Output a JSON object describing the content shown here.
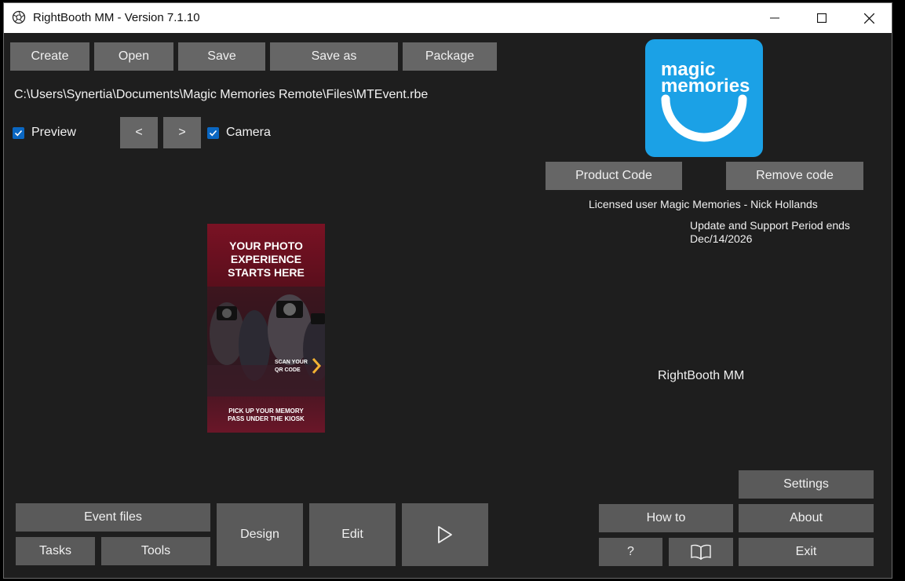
{
  "window": {
    "title": "RightBooth MM - Version 7.1.10"
  },
  "toolbar": {
    "create": "Create",
    "open": "Open",
    "save": "Save",
    "save_as": "Save as",
    "package": "Package"
  },
  "file_path": "C:\\Users\\Synertia\\Documents\\Magic Memories Remote\\Files\\MTEvent.rbe",
  "preview_check": {
    "label": "Preview",
    "checked": true
  },
  "camera_check": {
    "label": "Camera",
    "checked": true
  },
  "nav": {
    "prev": "<",
    "next": ">"
  },
  "logo": {
    "line1": "magic",
    "line2": "memories",
    "bg_color": "#1ba1e6"
  },
  "license": {
    "product_code": "Product Code",
    "remove_code": "Remove code",
    "licensed_user": "Licensed user Magic Memories - Nick Hollands",
    "support_line1": "Update and Support Period ends",
    "support_line2": "Dec/14/2026"
  },
  "app_name_label": "RightBooth MM",
  "poster": {
    "headline1": "YOUR PHOTO",
    "headline2": "EXPERIENCE",
    "headline3": "STARTS HERE",
    "scan1": "SCAN YOUR",
    "scan2": "QR CODE",
    "footer1": "PICK UP YOUR MEMORY",
    "footer2": "PASS UNDER THE KIOSK"
  },
  "bottom_left": {
    "event_files": "Event files",
    "tasks": "Tasks",
    "tools": "Tools",
    "design": "Design",
    "edit": "Edit"
  },
  "bottom_right": {
    "settings": "Settings",
    "how_to": "How to",
    "about": "About",
    "help": "?",
    "exit": "Exit"
  },
  "icons": {
    "app": "aperture-icon",
    "minimize": "minimize-icon",
    "maximize": "maximize-icon",
    "close": "close-icon",
    "play": "play-icon",
    "manual": "book-icon",
    "check": "checkmark-icon"
  }
}
